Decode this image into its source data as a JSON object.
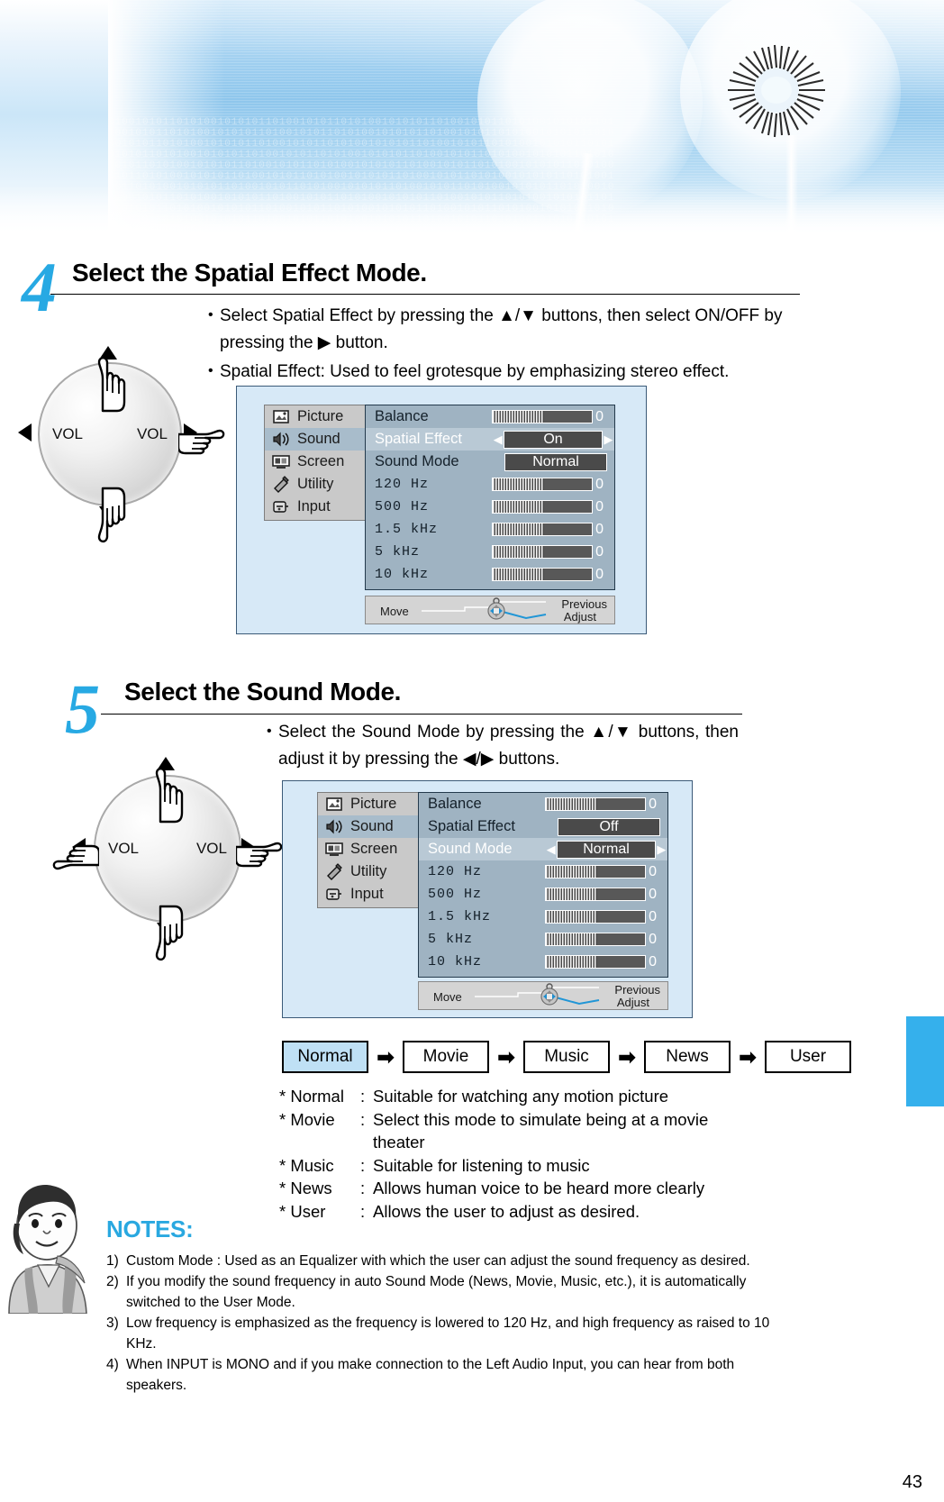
{
  "page": {
    "number": "43"
  },
  "steps": [
    {
      "number": "4",
      "title": "Select the Spatial Effect Mode.",
      "bullets": [
        "Select Spatial Effect by pressing the ▲/▼ buttons, then select ON/OFF by pressing the ▶ button.",
        "Spatial Effect: Used to feel grotesque by emphasizing stereo effect."
      ]
    },
    {
      "number": "5",
      "title": "Select the Sound Mode.",
      "bullets": [
        "Select the Sound Mode by pressing the ▲/▼ buttons, then adjust it by pressing the ◀/▶ buttons."
      ]
    }
  ],
  "dial": {
    "left_label": "VOL",
    "right_label": "VOL"
  },
  "osd1": {
    "sidebar": [
      {
        "label": "Picture",
        "icon": "picture-icon",
        "selected": false
      },
      {
        "label": "Sound",
        "icon": "sound-icon",
        "selected": true
      },
      {
        "label": "Screen",
        "icon": "screen-icon",
        "selected": false
      },
      {
        "label": "Utility",
        "icon": "utility-icon",
        "selected": false
      },
      {
        "label": "Input",
        "icon": "input-icon",
        "selected": false
      }
    ],
    "rows": [
      {
        "label": "Balance",
        "type": "bar",
        "value": "0",
        "highlight": false
      },
      {
        "label": "Spatial Effect",
        "type": "option",
        "value": "On",
        "highlight": true,
        "arrows": true
      },
      {
        "label": "Sound Mode",
        "type": "option",
        "value": "Normal",
        "highlight": false,
        "arrows": false
      },
      {
        "label": "120  Hz",
        "type": "bar",
        "value": "0",
        "highlight": false,
        "mono": true
      },
      {
        "label": "500  Hz",
        "type": "bar",
        "value": "0",
        "highlight": false,
        "mono": true
      },
      {
        "label": "1.5  kHz",
        "type": "bar",
        "value": "0",
        "highlight": false,
        "mono": true
      },
      {
        "label": "5     kHz",
        "type": "bar",
        "value": "0",
        "highlight": false,
        "mono": true
      },
      {
        "label": "10    kHz",
        "type": "bar",
        "value": "0",
        "highlight": false,
        "mono": true
      }
    ],
    "footer": {
      "move": "Move",
      "previous": "Previous",
      "adjust": "Adjust"
    }
  },
  "osd2": {
    "sidebar": [
      {
        "label": "Picture",
        "icon": "picture-icon",
        "selected": false
      },
      {
        "label": "Sound",
        "icon": "sound-icon",
        "selected": true
      },
      {
        "label": "Screen",
        "icon": "screen-icon",
        "selected": false
      },
      {
        "label": "Utility",
        "icon": "utility-icon",
        "selected": false
      },
      {
        "label": "Input",
        "icon": "input-icon",
        "selected": false
      }
    ],
    "rows": [
      {
        "label": "Balance",
        "type": "bar",
        "value": "0",
        "highlight": false
      },
      {
        "label": "Spatial Effect",
        "type": "option",
        "value": "Off",
        "highlight": false,
        "arrows": false
      },
      {
        "label": "Sound Mode",
        "type": "option",
        "value": "Normal",
        "highlight": true,
        "arrows": true
      },
      {
        "label": "120  Hz",
        "type": "bar",
        "value": "0",
        "highlight": false,
        "mono": true
      },
      {
        "label": "500  Hz",
        "type": "bar",
        "value": "0",
        "highlight": false,
        "mono": true
      },
      {
        "label": "1.5  kHz",
        "type": "bar",
        "value": "0",
        "highlight": false,
        "mono": true
      },
      {
        "label": "5     kHz",
        "type": "bar",
        "value": "0",
        "highlight": false,
        "mono": true
      },
      {
        "label": "10    kHz",
        "type": "bar",
        "value": "0",
        "highlight": false,
        "mono": true
      }
    ],
    "footer": {
      "move": "Move",
      "previous": "Previous",
      "adjust": "Adjust"
    }
  },
  "flow": {
    "items": [
      "Normal",
      "Movie",
      "Music",
      "News",
      "User"
    ],
    "arrow": "➡",
    "highlight_color": "#bfe0f5"
  },
  "mode_descriptions": [
    {
      "key": "* Normal",
      "colon": ":",
      "text": "Suitable for watching any motion picture",
      "cont": ""
    },
    {
      "key": "* Movie",
      "colon": ":",
      "text": "Select this mode to simulate being at a movie",
      "cont": "theater"
    },
    {
      "key": "* Music",
      "colon": ":",
      "text": "Suitable for listening to music",
      "cont": ""
    },
    {
      "key": "* News",
      "colon": ":",
      "text": "Allows human voice to be heard more clearly",
      "cont": ""
    },
    {
      "key": "* User",
      "colon": ":",
      "text": "Allows the user to adjust as desired.",
      "cont": ""
    }
  ],
  "notes": {
    "title": "NOTES:",
    "items": [
      {
        "num": "1)",
        "text": "Custom Mode : Used as an Equalizer with which the user can adjust the sound frequency as desired.",
        "cont": ""
      },
      {
        "num": "2)",
        "text": "If you modify the sound frequency in auto Sound Mode (News, Movie, Music, etc.), it is automatically",
        "cont": "switched to the User Mode."
      },
      {
        "num": "3)",
        "text": "Low frequency is emphasized as the frequency is lowered to 120 Hz, and high frequency as raised to 10",
        "cont": "KHz."
      },
      {
        "num": "4)",
        "text": "When INPUT is MONO and if you make connection to the Left Audio Input, you can hear from both",
        "cont": "speakers."
      }
    ]
  },
  "colors": {
    "accent": "#27a9e3",
    "tab": "#35b0ec",
    "osd_bg": "#d7e9f7",
    "osd_panel": "#9fb3c2"
  },
  "banner": {
    "binary_text": "01001010110101001010101101001010110101001010101101001010110101001010101101"
  }
}
